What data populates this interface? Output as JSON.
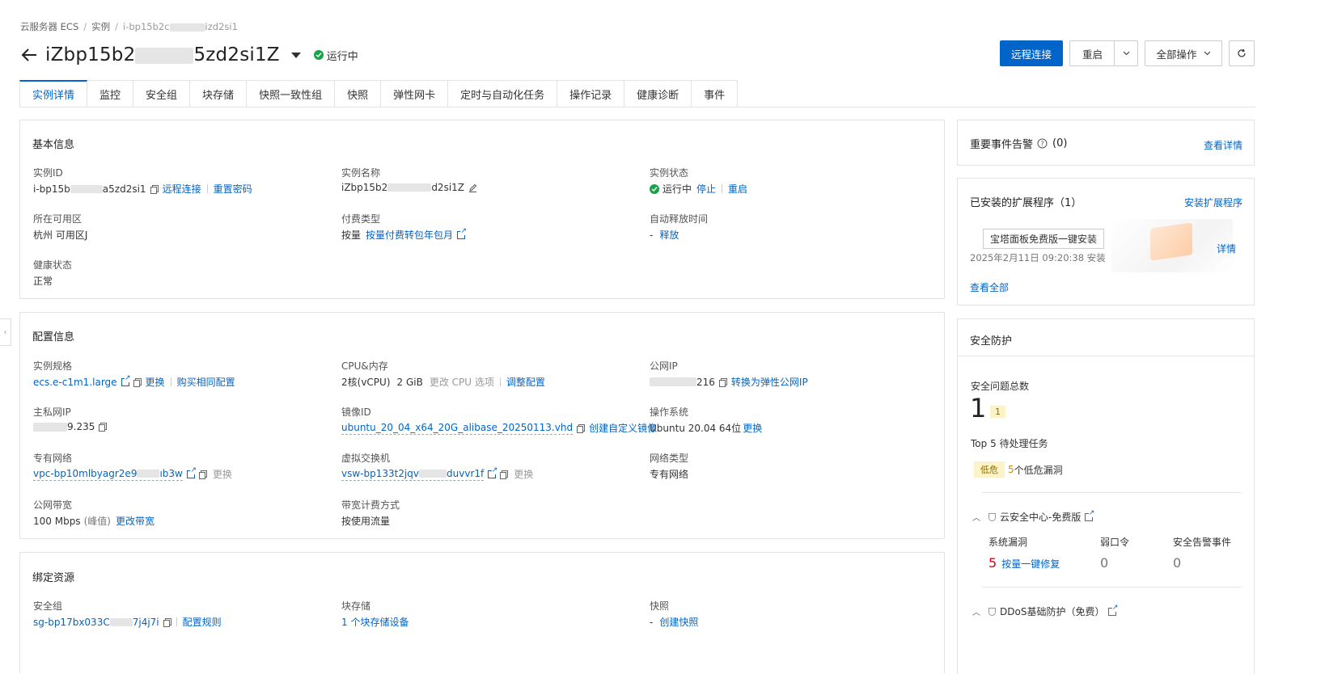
{
  "breadcrumb": {
    "root": "云服务器 ECS",
    "sep": "/",
    "instances": "实例",
    "current_a": "i-bp15b2c",
    "current_b": "izd2si1"
  },
  "header": {
    "title_a": "iZbp15b2",
    "title_b": "5zd2si1Z",
    "status": "运行中",
    "btn_remote": "远程连接",
    "btn_restart": "重启",
    "btn_all": "全部操作"
  },
  "tabs": [
    "实例详情",
    "监控",
    "安全组",
    "块存储",
    "快照一致性组",
    "快照",
    "弹性网卡",
    "定时与自动化任务",
    "操作记录",
    "健康诊断",
    "事件"
  ],
  "basic": {
    "title": "基本信息",
    "instance_id_label": "实例ID",
    "instance_id_a": "i-bp15b",
    "instance_id_b": "a5zd2si1",
    "remote_link": "远程连接",
    "reset_pwd": "重置密码",
    "name_label": "实例名称",
    "name_a": "iZbp15b2",
    "name_b": "d2si1Z",
    "state_label": "实例状态",
    "state_value": "运行中",
    "stop": "停止",
    "restart": "重启",
    "zone_label": "所在可用区",
    "zone_value": "杭州 可用区J",
    "pay_label": "付费类型",
    "pay_value": "按量",
    "pay_convert": "按量付费转包年包月",
    "release_label": "自动释放时间",
    "release_value": "-",
    "release_link": "释放",
    "health_label": "健康状态",
    "health_value": "正常"
  },
  "config": {
    "title": "配置信息",
    "spec_label": "实例规格",
    "spec_value": "ecs.e-c1m1.large",
    "spec_change": "更换",
    "spec_buy": "购买相同配置",
    "cpu_label": "CPU&内存",
    "cpu_value": "2核(vCPU)",
    "mem_value": "2 GiB",
    "cpu_change_opt": "更改 CPU 选项",
    "cpu_adjust": "调整配置",
    "pubip_label": "公网IP",
    "pubip_b": "216",
    "pubip_convert": "转换为弹性公网IP",
    "privip_label": "主私网IP",
    "privip_b": "9.235",
    "image_label": "镜像ID",
    "image_value": "ubuntu_20_04_x64_20G_alibase_20250113.vhd",
    "image_create": "创建自定义镜像",
    "os_label": "操作系统",
    "os_value": "Ubuntu 20.04 64位",
    "os_change": "更换",
    "vpc_label": "专有网络",
    "vpc_a": "vpc-bp10mlbyagr2e9",
    "vpc_b": "ıb3w",
    "vpc_change": "更换",
    "vsw_label": "虚拟交换机",
    "vsw_a": "vsw-bp133t2jqv",
    "vsw_b": "duvvr1f",
    "vsw_change": "更换",
    "nettype_label": "网络类型",
    "nettype_value": "专有网络",
    "bw_label": "公网带宽",
    "bw_value": "100 Mbps",
    "bw_peak": "(峰值)",
    "bw_change": "更改带宽",
    "bwbill_label": "带宽计费方式",
    "bwbill_value": "按使用流量"
  },
  "bind": {
    "title": "绑定资源",
    "sg_label": "安全组",
    "sg_a": "sg-bp17bx033C",
    "sg_b": "7j4j7i",
    "sg_rule": "配置规则",
    "disk_label": "块存储",
    "disk_value": "1 个块存储设备",
    "snap_label": "快照",
    "snap_value": "-",
    "snap_create": "创建快照"
  },
  "events": {
    "title": "重要事件告警",
    "count": "(0)",
    "link": "查看详情"
  },
  "ext": {
    "title": "已安装的扩展程序（1）",
    "install_link": "安装扩展程序",
    "plugin_name": "宝塔面板免费版一键安装",
    "plugin_time": "2025年2月11日 09:20:38 安装",
    "detail": "详情",
    "view_all": "查看全部"
  },
  "security": {
    "title": "安全防护",
    "total_label": "安全问题总数",
    "total_value": "1",
    "total_badge": "1",
    "top5_label": "Top 5 待处理任务",
    "risk_level": "低危",
    "risk_count": "5",
    "risk_text": "个低危漏洞",
    "center_title": "云安全中心-免费版",
    "col1": "系统漏洞",
    "col2": "弱口令",
    "col3": "安全告警事件",
    "v1": "5",
    "v1_link": "按量一键修复",
    "v2": "0",
    "v3": "0",
    "ddos_title": "DDoS基础防护（免费）"
  },
  "colors": {
    "accent": "#0064c8",
    "ok": "#16a34a",
    "danger": "#d9001b"
  }
}
